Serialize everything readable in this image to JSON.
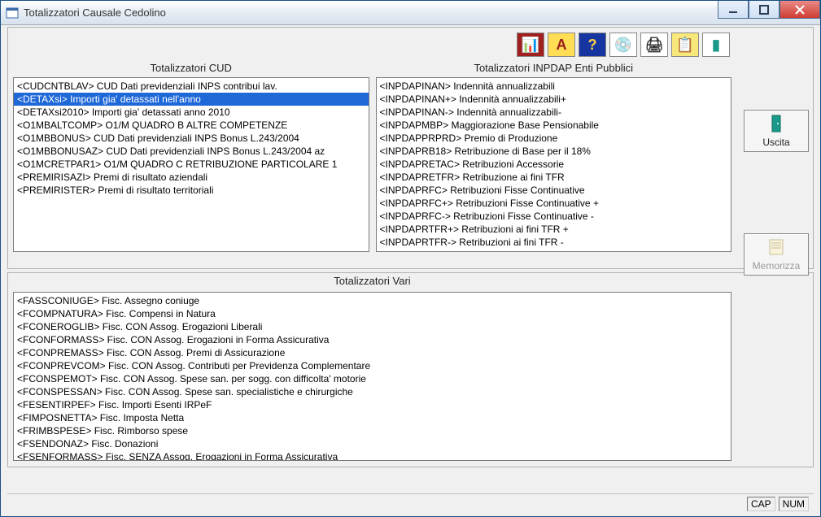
{
  "window": {
    "title": "Totalizzatori Causale Cedolino"
  },
  "toolbar": {
    "icons": [
      {
        "name": "chart-icon",
        "glyph": "📊"
      },
      {
        "name": "text-format-icon",
        "glyph": "A"
      },
      {
        "name": "help-icon",
        "glyph": "?"
      },
      {
        "name": "disc-icon",
        "glyph": "💿"
      },
      {
        "name": "print-icon",
        "glyph": "🖨"
      },
      {
        "name": "notes-icon",
        "glyph": "📋"
      },
      {
        "name": "exit-door-icon",
        "glyph": "▮"
      }
    ]
  },
  "sidebar": {
    "uscita": {
      "label": "Uscita"
    },
    "memorizza": {
      "label": "Memorizza"
    }
  },
  "headers": {
    "cud": "Totalizzatori CUD",
    "inpdap": "Totalizzatori INPDAP Enti Pubblici",
    "vari": "Totalizzatori Vari"
  },
  "lists": {
    "cud": [
      "<CUDCNTBLAV> CUD Dati previdenziali INPS contribui lav.",
      "<DETAXsi> Importi gia' detassati nell'anno",
      "<DETAXsi2010> Importi gia' detassati anno 2010",
      "<O1MBALTCOMP> O1/M QUADRO B ALTRE COMPETENZE",
      "<O1MBBONUS> CUD Dati previdenziali INPS Bonus L.243/2004",
      "<O1MBBONUSAZ> CUD Dati previdenziali INPS Bonus L.243/2004 az",
      "<O1MCRETPAR1> O1/M QUADRO C RETRIBUZIONE PARTICOLARE 1",
      "<PREMIRISAZI> Premi di risultato aziendali",
      "<PREMIRISTER> Premi di risultato territoriali"
    ],
    "cud_selected": 1,
    "inpdap": [
      "<INPDAPINAN> Indennità annualizzabili",
      "<INPDAPINAN+> Indennità annualizzabili+",
      "<INPDAPINAN-> Indennità annualizzabili-",
      "<INPDAPMBP> Maggiorazione Base Pensionabile",
      "<INPDAPPRPRD> Premio di Produzione",
      "<INPDAPRB18> Retribuzione di Base per il 18%",
      "<INPDAPRETAC> Retribuzioni Accessorie",
      "<INPDAPRETFR> Retribuzione ai fini TFR",
      "<INPDAPRFC> Retribuzioni Fisse Continuative",
      "<INPDAPRFC+> Retribuzioni Fisse Continuative +",
      "<INPDAPRFC-> Retribuzioni Fisse Continuative -",
      "<INPDAPRTFR+> Retribuzioni ai fini TFR +",
      "<INPDAPRTFR-> Retribuzioni ai fini TFR -"
    ],
    "vari": [
      "<FASSCONIUGE> Fisc. Assegno coniuge",
      "<FCOMPNATURA> Fisc. Compensi in Natura",
      "<FCONEROGLIB> Fisc. CON Assog. Erogazioni Liberali",
      "<FCONFORMASS> Fisc. CON Assog. Erogazioni in Forma Assicurativa",
      "<FCONPREMASS> Fisc. CON Assog. Premi di Assicurazione",
      "<FCONPREVCOM> Fisc. CON Assog. Contributi per Previdenza Complementare",
      "<FCONSPEMOT> Fisc. CON Assog. Spese san. per sogg. con difficolta' motorie",
      "<FCONSPESSAN> Fisc. CON Assog. Spese san. specialistiche e chirurgiche",
      "<FESENTIRPEF> Fisc. Importi Esenti IRPeF",
      "<FIMPOSNETTA> Fisc. Imposta Netta",
      "<FRIMBSPESE> Fisc. Rimborso spese",
      "<FSENDONAZ> Fisc. Donazioni",
      "<FSENFORMASS> Fisc. SENZA Assog. Erogazioni in Forma Assicurativa"
    ]
  },
  "statusbar": {
    "cap": "CAP",
    "num": "NUM"
  }
}
